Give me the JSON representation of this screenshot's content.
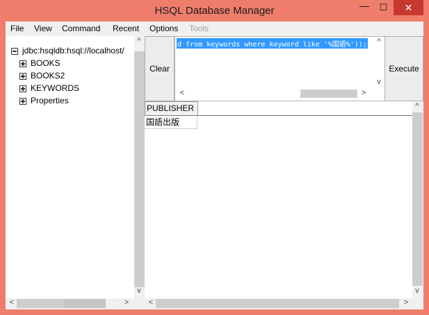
{
  "window": {
    "title": "HSQL Database Manager",
    "controls": {
      "minimize": "—",
      "maximize": "☐",
      "close": "✕"
    }
  },
  "menu": [
    "File",
    "View",
    "Command",
    "Recent",
    "Options",
    "Tools"
  ],
  "tree": {
    "root": "jdbc:hsqldb:hsql://localhost/",
    "nodes": [
      "BOOKS",
      "BOOKS2",
      "KEYWORDS",
      "Properties"
    ]
  },
  "query": {
    "clear_label": "Clear",
    "execute_label": "Execute",
    "sql_text": "d from keywords where keyword like '%国語%'));"
  },
  "results": {
    "columns": [
      "PUBLISHER"
    ],
    "rows": [
      [
        "国語出版"
      ]
    ]
  },
  "scroll": {
    "up": "^",
    "down": "v",
    "left": "<",
    "right": ">"
  },
  "colors": {
    "titlebar": "#ef7d6c",
    "selection": "#3399ff",
    "close_button": "#c7392f"
  }
}
